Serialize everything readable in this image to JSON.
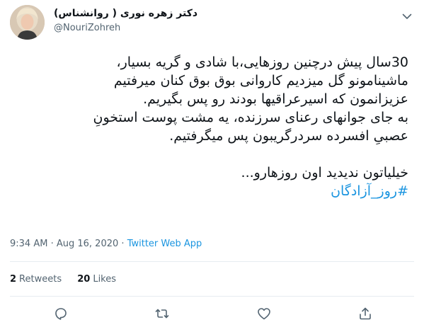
{
  "user": {
    "display_name": "دکتر زهره نوری ( روانشناس)",
    "handle": "@NouriZohreh"
  },
  "tweet": {
    "lines": [
      "30سال پیش درچنین روزهایی،با شادی و گریه بسیار،",
      "ماشینامونو گل میزدیم کاروانی بوق بوق کنان میرفتیم",
      "عزیزانمون که اسیرعراقیها بودند رو پس بگیریم.",
      "به جای جوانهای رعنای سرزنده، یه مشت پوست استخونِ",
      "عصبیِ افسرده سردرگریبون پس میگرفتیم."
    ],
    "closing_line": "خیلیاتون ندیدید اون روزهارو...",
    "hashtag": "#روز_آزادگان"
  },
  "meta": {
    "time": "9:34 AM",
    "separator1": "·",
    "date": "Aug 16, 2020",
    "separator2": "·",
    "source": "Twitter Web App"
  },
  "stats": {
    "retweets_count": "2",
    "retweets_label": "Retweets",
    "likes_count": "20",
    "likes_label": "Likes"
  },
  "icons": {
    "caret": "chevron-down-icon",
    "reply": "reply-icon",
    "retweet": "retweet-icon",
    "like": "heart-icon",
    "share": "share-icon"
  },
  "colors": {
    "link": "#1b95e0",
    "secondary_text": "#536471",
    "divider": "#e6ecf0"
  }
}
